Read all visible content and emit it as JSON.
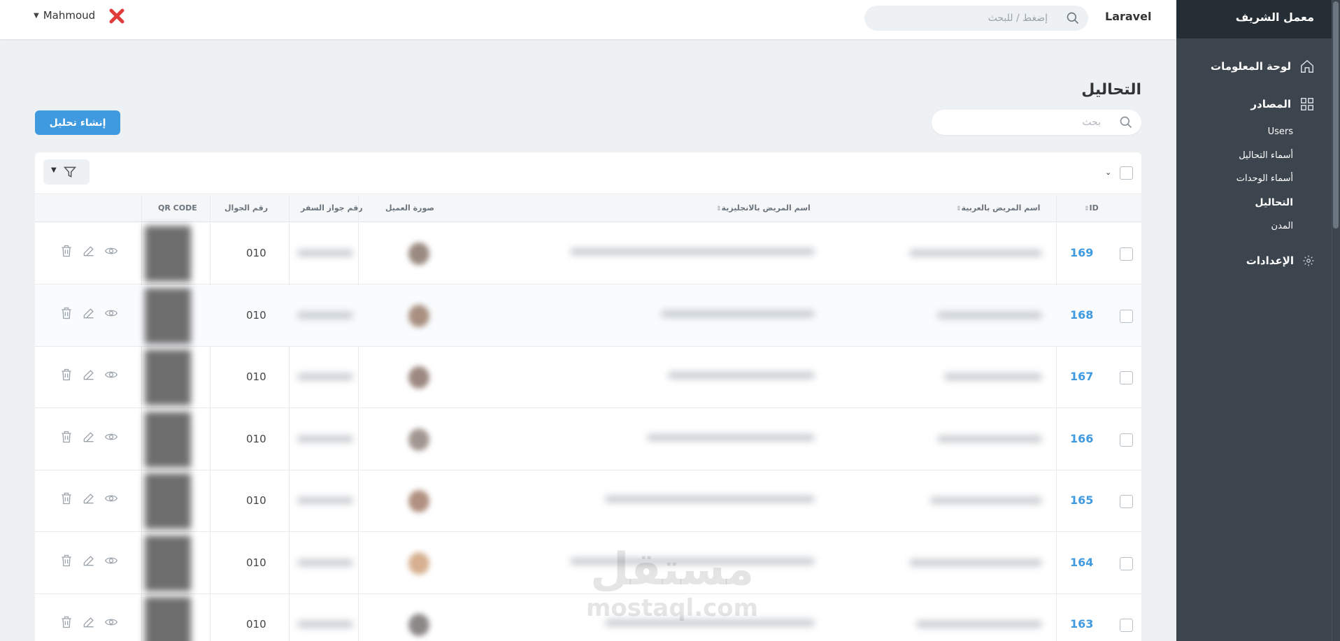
{
  "topbar": {
    "search_placeholder": "إضغط / للبحث",
    "app_name": "Laravel",
    "user_name": "Mahmoud"
  },
  "sidebar": {
    "brand": "معمل الشريف",
    "dashboard": "لوحة المعلومات",
    "resources": "المصادر",
    "items": [
      "Users",
      "أسماء التحاليل",
      "أسماء الوحدات",
      "التحاليل",
      "المدن"
    ],
    "active_item": "التحاليل",
    "settings": "الإعدادات"
  },
  "page": {
    "title": "التحاليل",
    "search_placeholder": "بحث",
    "create_button": "إنشاء تحليل"
  },
  "table": {
    "columns": [
      "ID",
      "اسم المريض بالعربية",
      "اسم المريض بالانجليزية",
      "صورة العميل",
      "رقم جواز السفر",
      "رقم الجوال",
      "QR CODE"
    ],
    "rows": [
      {
        "id": "169",
        "phone": "010"
      },
      {
        "id": "168",
        "phone": "010"
      },
      {
        "id": "167",
        "phone": "010"
      },
      {
        "id": "166",
        "phone": "010"
      },
      {
        "id": "165",
        "phone": "010"
      },
      {
        "id": "164",
        "phone": "010"
      },
      {
        "id": "163",
        "phone": "010"
      }
    ]
  },
  "watermark": {
    "arabic": "مستقل",
    "latin": "mostaql.com"
  },
  "colors": {
    "accent": "#3f9ae0",
    "sidebar": "#3c454e",
    "brand_bar": "#252d35"
  }
}
